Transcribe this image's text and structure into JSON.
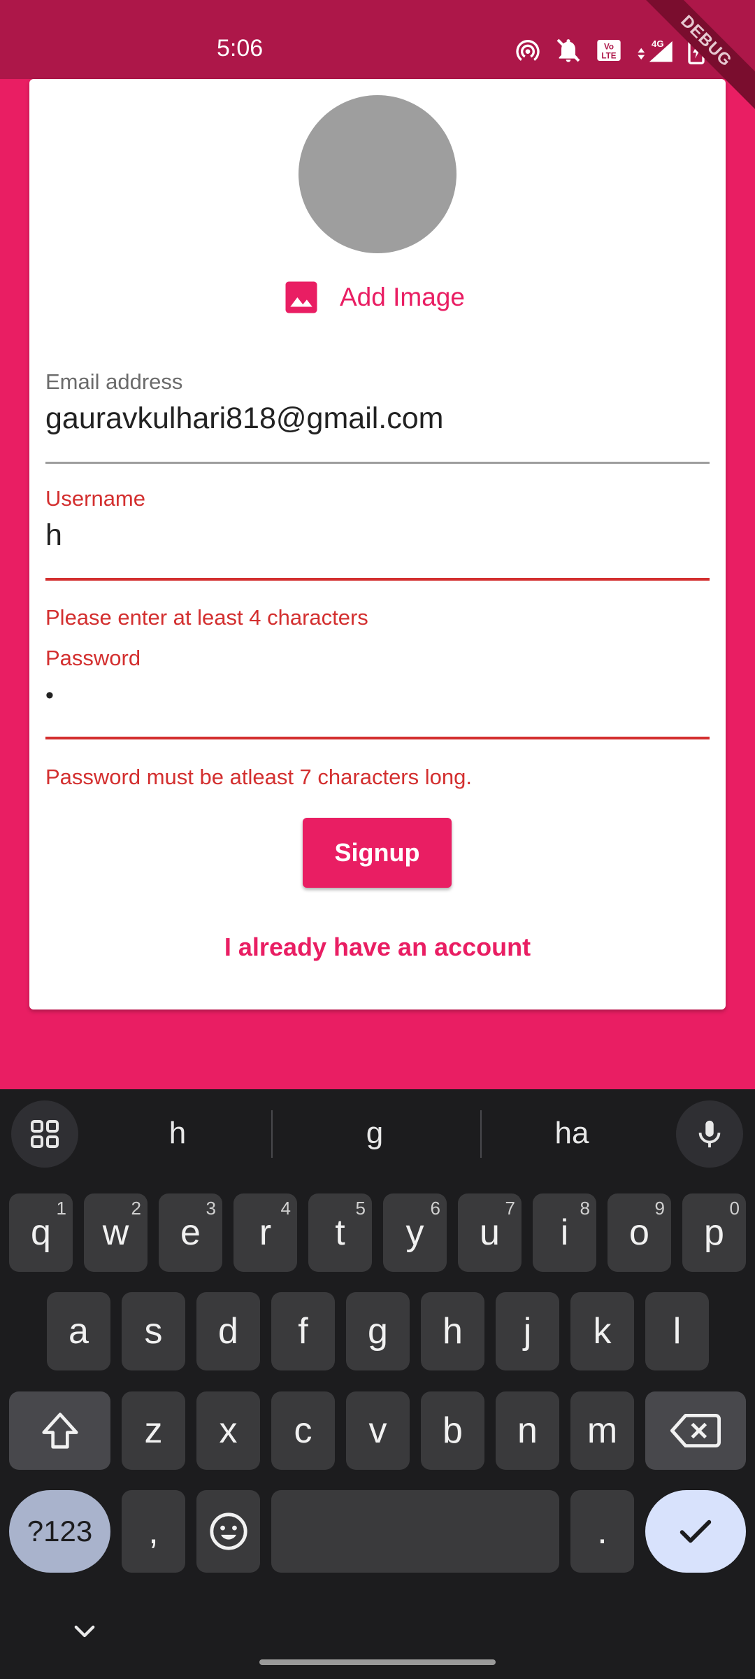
{
  "status_bar": {
    "time": "5:06",
    "debug_label": "DEBUG"
  },
  "form": {
    "add_image_label": "Add Image",
    "email": {
      "label": "Email address",
      "value": "gauravkulhari818@gmail.com"
    },
    "username": {
      "label": "Username",
      "value": "h",
      "error": "Please enter at least 4 characters"
    },
    "password": {
      "label": "Password",
      "value": "•",
      "error": "Password must be atleast 7 characters long."
    },
    "signup_label": "Signup",
    "login_link": "I already have an account"
  },
  "colors": {
    "primary": "#e91e63",
    "status_bar": "#ad1749",
    "error": "#d32f2f",
    "avatar": "#9e9e9e"
  },
  "keyboard": {
    "suggestions": [
      "h",
      "g",
      "ha"
    ],
    "row1": [
      {
        "k": "q",
        "h": "1"
      },
      {
        "k": "w",
        "h": "2"
      },
      {
        "k": "e",
        "h": "3"
      },
      {
        "k": "r",
        "h": "4"
      },
      {
        "k": "t",
        "h": "5"
      },
      {
        "k": "y",
        "h": "6"
      },
      {
        "k": "u",
        "h": "7"
      },
      {
        "k": "i",
        "h": "8"
      },
      {
        "k": "o",
        "h": "9"
      },
      {
        "k": "p",
        "h": "0"
      }
    ],
    "row2": [
      "a",
      "s",
      "d",
      "f",
      "g",
      "h",
      "j",
      "k",
      "l"
    ],
    "row3": [
      "z",
      "x",
      "c",
      "v",
      "b",
      "n",
      "m"
    ],
    "symbols_label": "?123",
    "comma": ",",
    "period": "."
  }
}
